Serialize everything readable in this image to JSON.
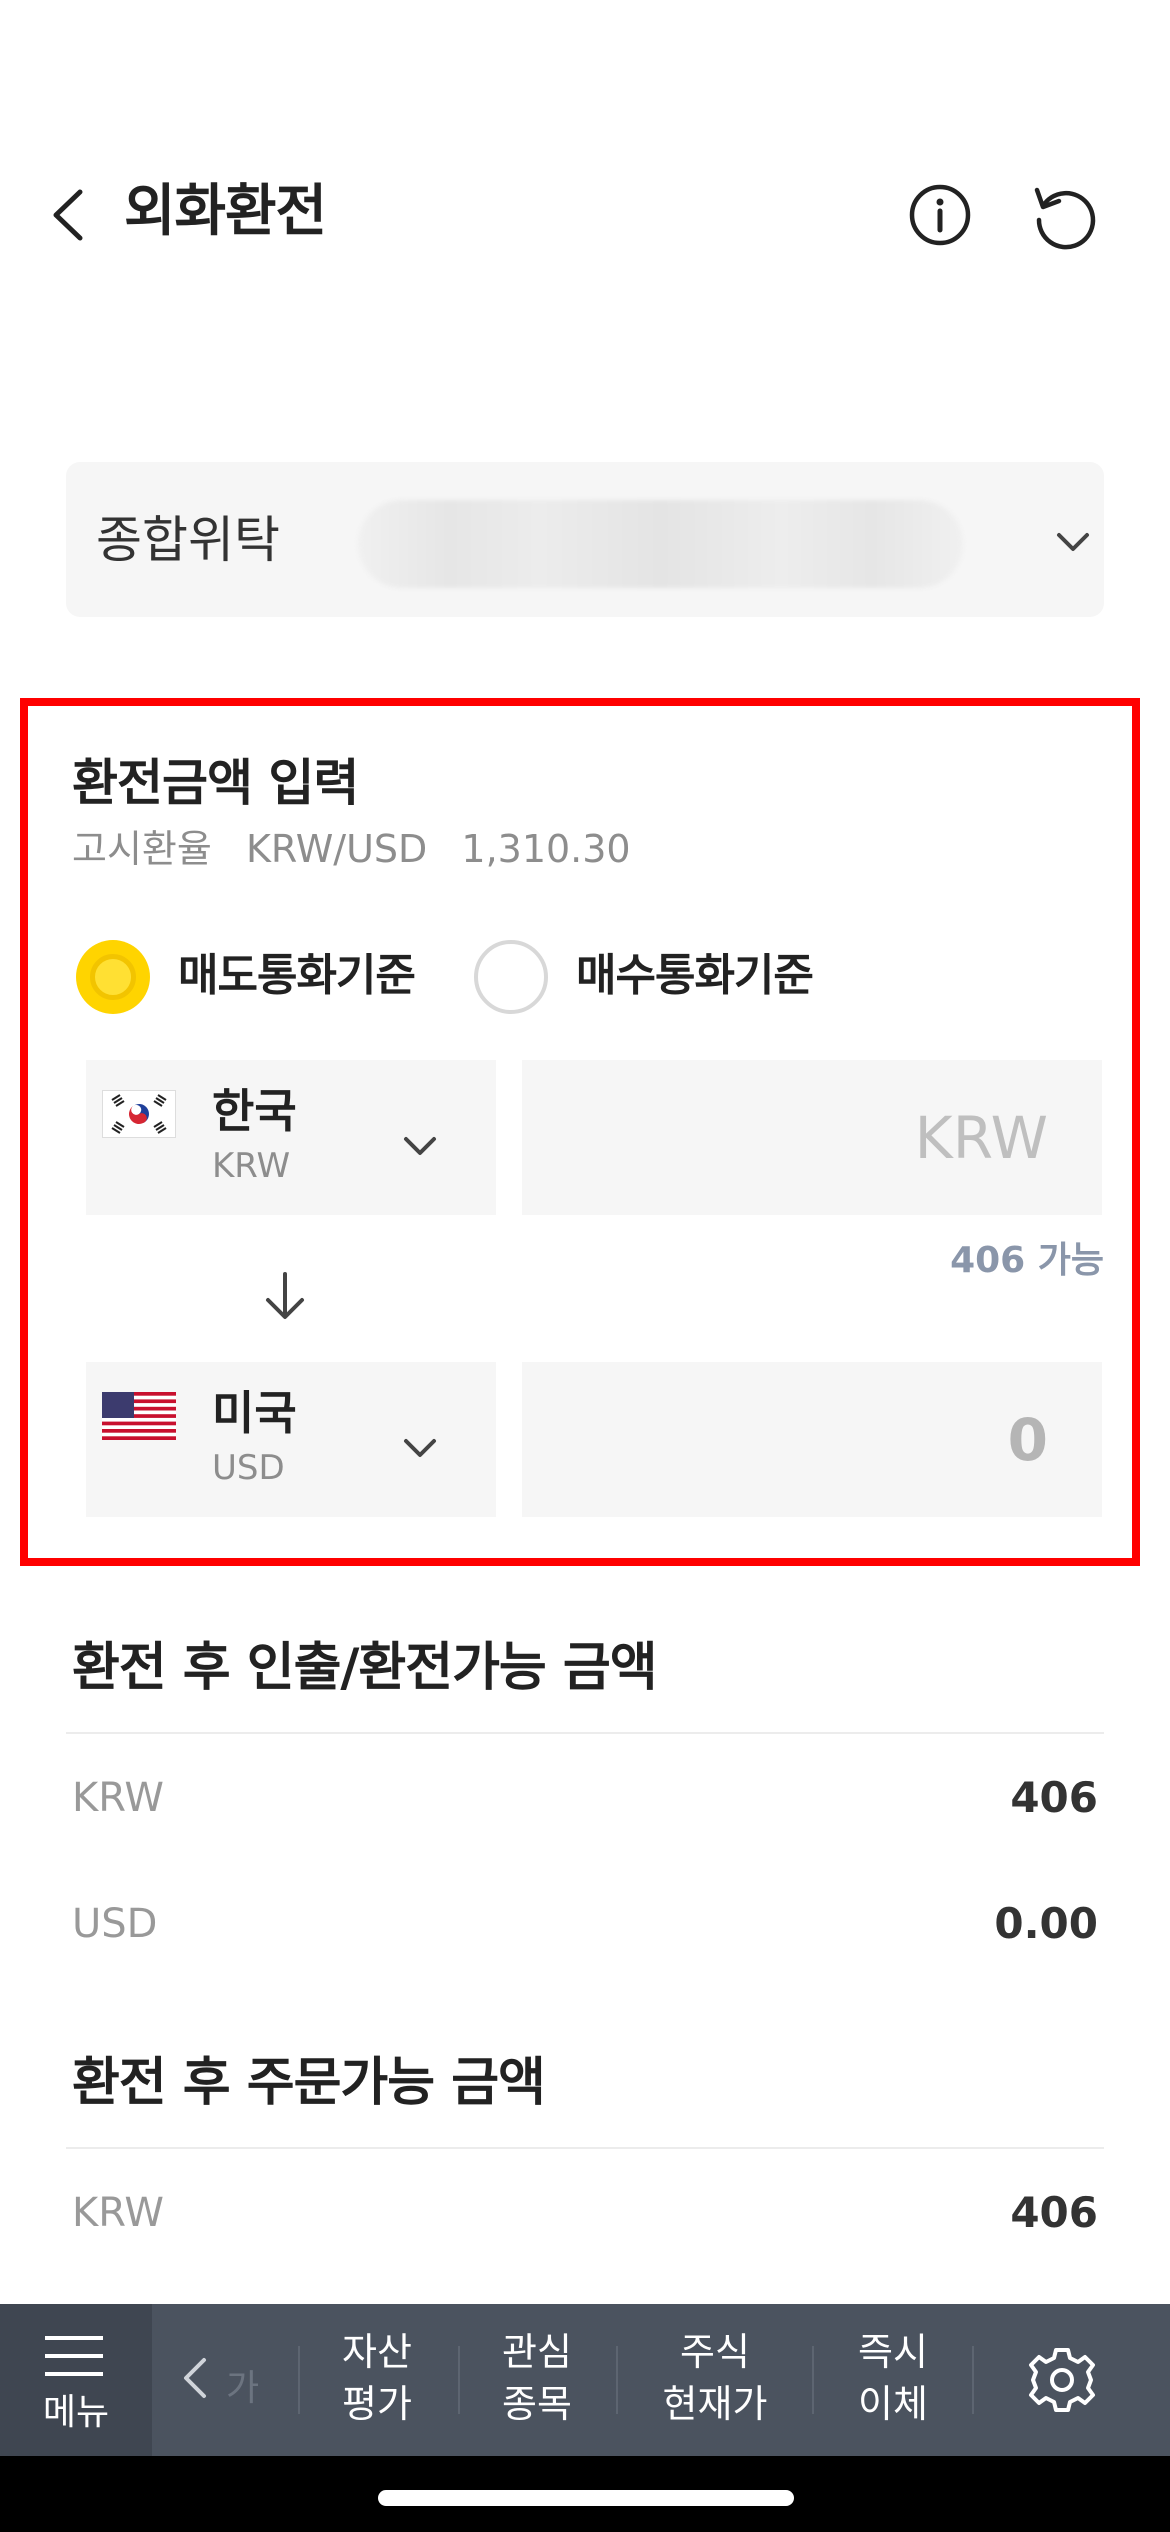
{
  "header": {
    "title": "외화환전"
  },
  "account": {
    "type_label": "종합위탁"
  },
  "exchange": {
    "section_title": "환전금액 입력",
    "rate_label": "고시환율",
    "rate_pair": "KRW/USD",
    "rate_value": "1,310.30",
    "radio_sell": "매도통화기준",
    "radio_buy": "매수통화기준",
    "selected_basis": "매도통화기준",
    "from_currency": {
      "name": "한국",
      "code": "KRW"
    },
    "from_placeholder": "KRW",
    "available_text": "406 가능",
    "to_currency": {
      "name": "미국",
      "code": "USD"
    },
    "to_amount": "0"
  },
  "withdrawable": {
    "title": "환전 후 인출/환전가능 금액",
    "rows": [
      {
        "label": "KRW",
        "value": "406"
      },
      {
        "label": "USD",
        "value": "0.00"
      }
    ]
  },
  "orderable": {
    "title": "환전 후 주문가능 금액",
    "rows": [
      {
        "label": "KRW",
        "value": "406"
      }
    ]
  },
  "tabbar": {
    "menu_label": "메뉴",
    "ghost_label": "가",
    "tabs": [
      {
        "line1": "자산",
        "line2": "평가"
      },
      {
        "line1": "관심",
        "line2": "종목"
      },
      {
        "line1": "주식",
        "line2": "현재가"
      },
      {
        "line1": "즉시",
        "line2": "이체"
      }
    ]
  },
  "colors": {
    "accent_yellow": "#ffd400",
    "highlight_red": "#ff0000",
    "tabbar_bg": "#4b535f",
    "available_text": "#8a96aa"
  }
}
